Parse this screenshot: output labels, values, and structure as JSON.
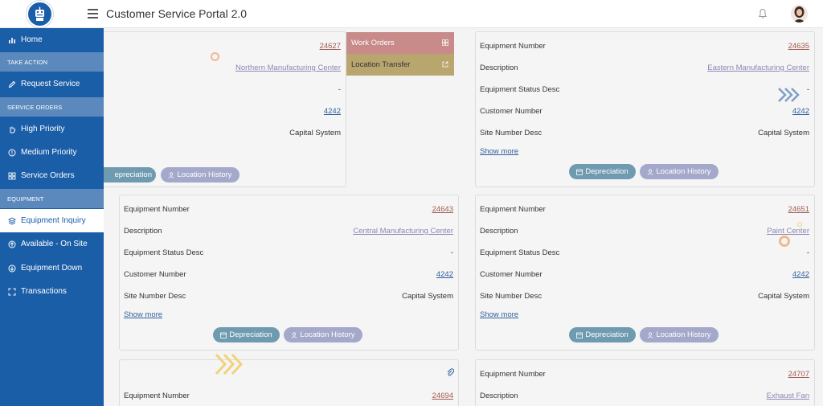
{
  "header": {
    "title": "Customer Service Portal 2.0"
  },
  "sidebar": {
    "items": [
      {
        "label": "Home",
        "icon": "bar-chart-icon"
      },
      {
        "section": "TAKE ACTION"
      },
      {
        "label": "Request Service",
        "icon": "pencil-icon"
      },
      {
        "section": "SERVICE ORDERS"
      },
      {
        "label": "High Priority",
        "icon": "hand-icon"
      },
      {
        "label": "Medium Priority",
        "icon": "alert-circle-icon"
      },
      {
        "label": "Service Orders",
        "icon": "grid-icon"
      },
      {
        "section": "EQUIPMENT"
      },
      {
        "label": "Equipment Inquiry",
        "icon": "layers-icon"
      },
      {
        "label": "Available - On Site",
        "icon": "arrow-up-circle-icon"
      },
      {
        "label": "Equipment Down",
        "icon": "arrow-down-circle-icon"
      },
      {
        "label": "Transactions",
        "icon": "expand-icon"
      }
    ]
  },
  "dropdown": {
    "work_orders": "Work Orders",
    "location_transfer": "Location Transfer"
  },
  "labels": {
    "equipment_number": "Equipment Number",
    "description": "Description",
    "status_desc": "Equipment Status Desc",
    "customer_number": "Customer Number",
    "site_desc": "Site Number Desc",
    "show_more": "Show more",
    "depreciation": "Depreciation",
    "depreciation_cut": "epreciation",
    "location_history": "Location History"
  },
  "cards": [
    {
      "equipment_number": "24627",
      "description": "Northern Manufacturing Center",
      "status": "-",
      "customer_number": "4242",
      "site": "Capital System"
    },
    {
      "equipment_number": "24635",
      "description": "Eastern Manufacturing Center",
      "status": "-",
      "customer_number": "4242",
      "site": "Capital System"
    },
    {
      "equipment_number": "24643",
      "description": "Central Manufacturing Center",
      "status": "-",
      "customer_number": "4242",
      "site": "Capital System"
    },
    {
      "equipment_number": "24651",
      "description": "Paint Center",
      "status": "-",
      "customer_number": "4242",
      "site": "Capital System"
    },
    {
      "equipment_number": "24694"
    },
    {
      "equipment_number": "24707",
      "description": "Exhaust Fan"
    }
  ],
  "colors": {
    "sidebar": "#1b5ea8",
    "section": "#5b89bd",
    "work_orders": "#c98a8a",
    "location_transfer": "#b9a66f"
  }
}
